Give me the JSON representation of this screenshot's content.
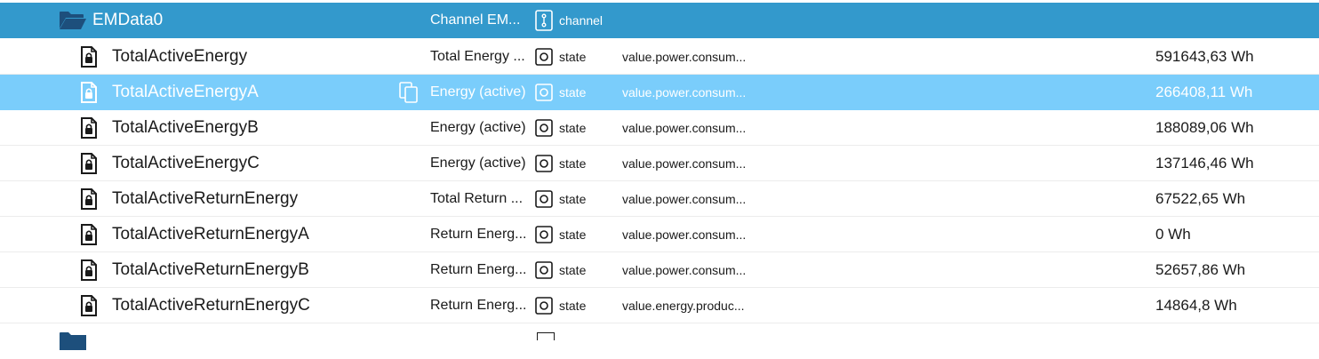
{
  "folder": {
    "name": "EMData0",
    "label": "Channel EM...",
    "type": "channel",
    "icon": "folder-open-icon",
    "type_icon": "channel-icon"
  },
  "states": [
    {
      "name": "TotalActiveEnergy",
      "label": "Total Energy ...",
      "type": "state",
      "role": "value.power.consum...",
      "value": "591643,63 Wh"
    },
    {
      "name": "TotalActiveEnergyA",
      "label": "Energy (active)",
      "type": "state",
      "role": "value.power.consum...",
      "value": "266408,11 Wh"
    },
    {
      "name": "TotalActiveEnergyB",
      "label": "Energy (active)",
      "type": "state",
      "role": "value.power.consum...",
      "value": "188089,06 Wh"
    },
    {
      "name": "TotalActiveEnergyC",
      "label": "Energy (active)",
      "type": "state",
      "role": "value.power.consum...",
      "value": "137146,46 Wh"
    },
    {
      "name": "TotalActiveReturnEnergy",
      "label": "Total Return ...",
      "type": "state",
      "role": "value.power.consum...",
      "value": "67522,65 Wh"
    },
    {
      "name": "TotalActiveReturnEnergyA",
      "label": "Return Energ...",
      "type": "state",
      "role": "value.power.consum...",
      "value": "0 Wh"
    },
    {
      "name": "TotalActiveReturnEnergyB",
      "label": "Return Energ...",
      "type": "state",
      "role": "value.power.consum...",
      "value": "52657,86 Wh"
    },
    {
      "name": "TotalActiveReturnEnergyC",
      "label": "Return Energ...",
      "type": "state",
      "role": "value.energy.produc...",
      "value": "14864,8 Wh"
    }
  ],
  "selected_index": 1,
  "icons": {
    "state": "file-lock-icon",
    "state_type": "state-type-icon",
    "copy": "copy-icon",
    "next_folder": "folder-icon"
  },
  "colors": {
    "folder_row_bg": "#3399cc",
    "selected_row_bg": "#7acdfb",
    "icon_dark": "#1a1a1a"
  }
}
